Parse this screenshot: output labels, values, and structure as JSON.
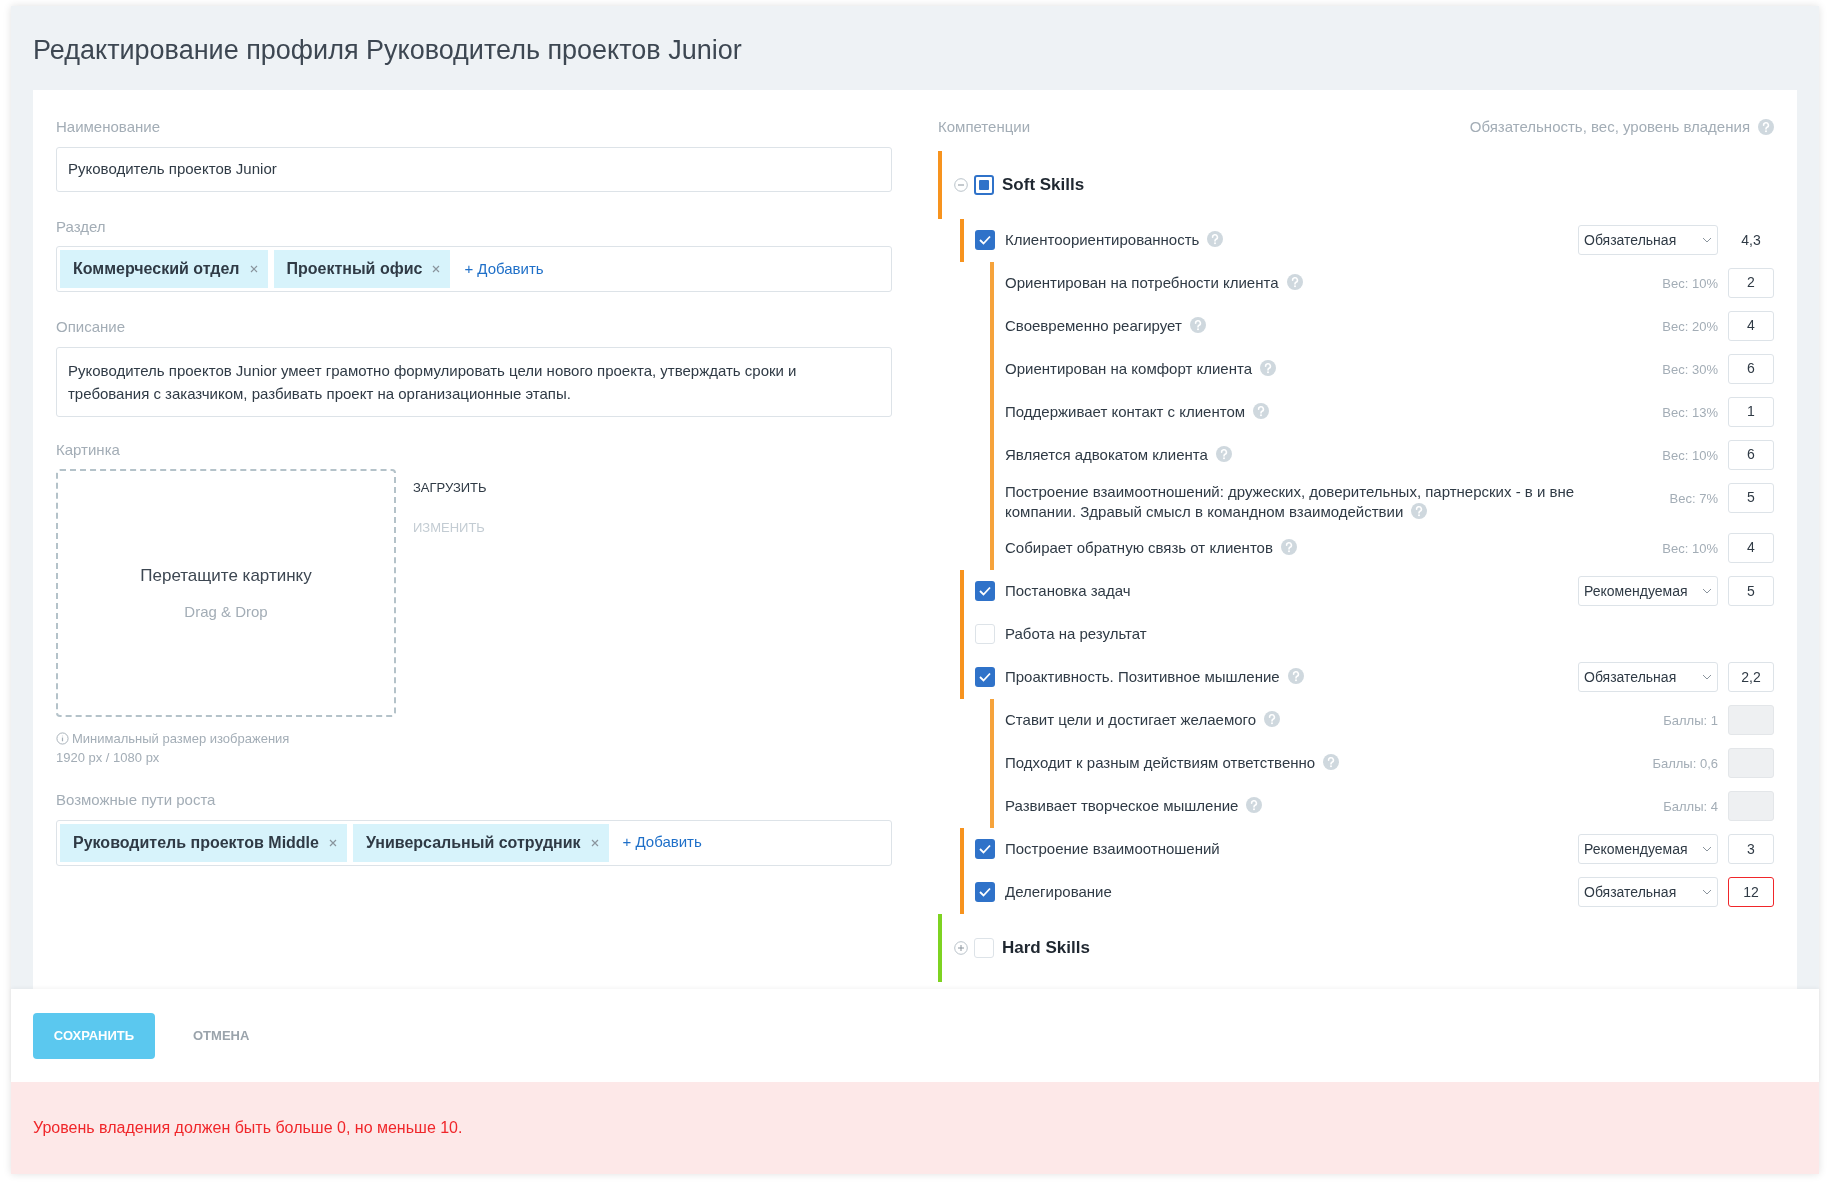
{
  "page_title": "Редактирование профиля Руководитель проектов Junior",
  "name_field": {
    "label": "Наименование",
    "value": "Руководитель проектов Junior"
  },
  "section_field": {
    "label": "Раздел",
    "tags": [
      "Коммерческий отдел",
      "Проектный офис"
    ],
    "add_link": "+ Добавить"
  },
  "description_field": {
    "label": "Описание",
    "value": "Руководитель проектов Junior умеет грамотно формулировать цели нового проекта, утверждать сроки и требования с заказчиком, разбивать проект на организационные этапы."
  },
  "picture_field": {
    "label": "Картинка",
    "drop_title": "Перетащите картинку",
    "drop_hint": "Drag & Drop",
    "actions": [
      {
        "label": "ЗАГРУЗИТЬ",
        "disabled": false
      },
      {
        "label": "ИЗМЕНИТЬ",
        "disabled": true
      }
    ],
    "hint_lines": [
      "Минимальный размер изображения",
      "1920 px / 1080 px"
    ]
  },
  "growth_field": {
    "label": "Возможные пути роста",
    "tags": [
      "Руководитель проектов Middle",
      "Универсальный сотрудник"
    ],
    "add_link": "+ Добавить"
  },
  "competencies": {
    "title": "Компетенции",
    "columns_label": "Обязательность, вес, уровень владения",
    "groups": [
      {
        "name": "Soft Skills",
        "color": "#f7931e",
        "expanded": true,
        "partial": true,
        "children": [
          {
            "name": "Клиентоориентированность",
            "checked": true,
            "help": true,
            "requirement": "Обязательная",
            "boxed": false,
            "value": "4,3",
            "invalid": false,
            "children": [
              {
                "name": "Ориентирован на потребности клиента",
                "help": true,
                "meta": "Вес: 10%",
                "value": "2",
                "disabled": false
              },
              {
                "name": "Своевременно реагирует",
                "help": true,
                "meta": "Вес: 20%",
                "value": "4",
                "disabled": false
              },
              {
                "name": "Ориентирован на комфорт клиента",
                "help": true,
                "meta": "Вес: 30%",
                "value": "6",
                "disabled": false
              },
              {
                "name": "Поддерживает контакт с клиентом",
                "help": true,
                "meta": "Вес: 13%",
                "value": "1",
                "disabled": false
              },
              {
                "name": "Является адвокатом клиента",
                "help": true,
                "meta": "Вес: 10%",
                "value": "6",
                "disabled": false
              },
              {
                "name": "Построение взаимоотношений: дружеских, доверительных, партнерских - в и вне компании. Здравый смысл в командном взаимодействии",
                "help": true,
                "meta": "Вес: 7%",
                "value": "5",
                "disabled": false
              },
              {
                "name": "Собирает обратную связь от клиентов",
                "help": true,
                "meta": "Вес: 10%",
                "value": "4",
                "disabled": false
              }
            ]
          },
          {
            "name": "Постановка задач",
            "checked": true,
            "help": false,
            "requirement": "Рекомендуемая",
            "boxed": true,
            "value": "5",
            "invalid": false
          },
          {
            "name": "Работа на результат",
            "checked": false,
            "help": false
          },
          {
            "name": "Проактивность. Позитивное мышление",
            "checked": true,
            "help": true,
            "requirement": "Обязательная",
            "boxed": true,
            "value": "2,2",
            "invalid": false,
            "children": [
              {
                "name": "Ставит цели и достигает желаемого",
                "help": true,
                "meta": "Баллы: 1",
                "disabled": true
              },
              {
                "name": "Подходит к разным действиям ответственно",
                "help": true,
                "meta": "Баллы: 0,6",
                "disabled": true
              },
              {
                "name": "Развивает творческое мышление",
                "help": true,
                "meta": "Баллы: 4",
                "disabled": true
              }
            ]
          },
          {
            "name": "Построение взаимоотношений",
            "checked": true,
            "help": false,
            "requirement": "Рекомендуемая",
            "boxed": true,
            "value": "3",
            "invalid": false
          },
          {
            "name": "Делегирование",
            "checked": true,
            "help": false,
            "requirement": "Обязательная",
            "boxed": true,
            "value": "12",
            "invalid": true
          }
        ]
      },
      {
        "name": "Hard Skills",
        "color": "#7ed321",
        "expanded": false,
        "partial": false
      }
    ]
  },
  "buttons": [
    {
      "label": "СОХРАНИТЬ",
      "kind": "primary"
    },
    {
      "label": "ОТМЕНА",
      "kind": "plain"
    }
  ],
  "error_message": "Уровень владения должен быть больше 0, но меньше 10."
}
